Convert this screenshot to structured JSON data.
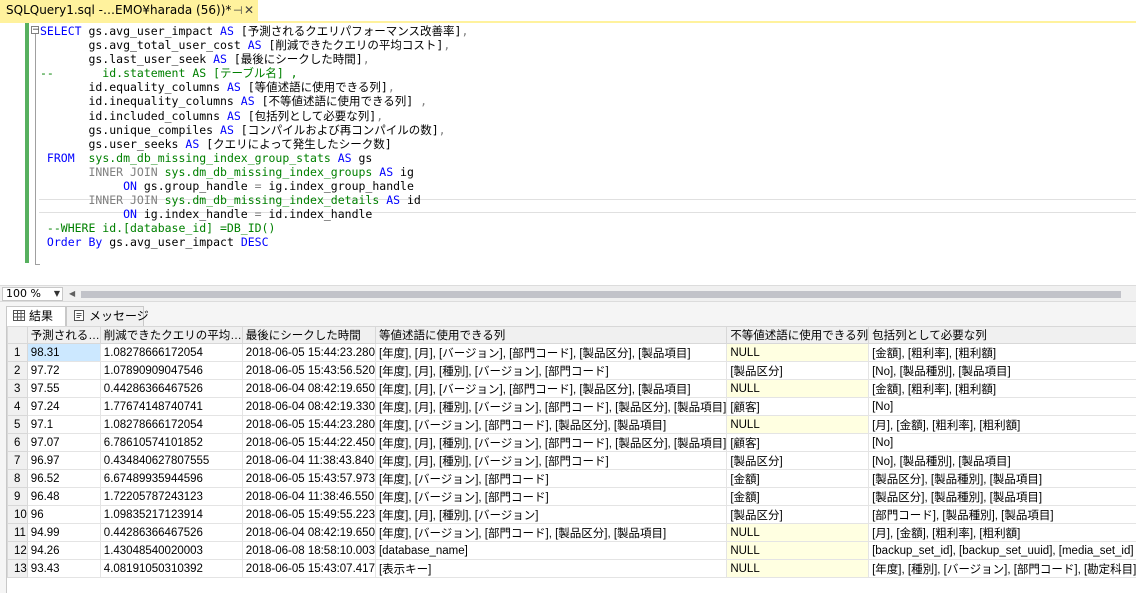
{
  "document_tab": {
    "title": "SQLQuery1.sql -…EMO¥harada (56))*",
    "pin_glyph": "⊣",
    "close_glyph": "✕"
  },
  "editor": {
    "lines": [
      [
        {
          "t": "SELECT ",
          "c": "kw"
        },
        {
          "t": "gs.avg_user_impact ",
          "c": ""
        },
        {
          "t": "AS ",
          "c": "kw"
        },
        {
          "t": "[予測されるクエリパフォーマンス改善率]",
          "c": ""
        },
        {
          "t": ",",
          "c": "gr"
        }
      ],
      [
        {
          "t": "       gs.avg_total_user_cost ",
          "c": ""
        },
        {
          "t": "AS ",
          "c": "kw"
        },
        {
          "t": "[削減できたクエリの平均コスト]",
          "c": ""
        },
        {
          "t": ",",
          "c": "gr"
        }
      ],
      [
        {
          "t": "       gs.last_user_seek ",
          "c": ""
        },
        {
          "t": "AS ",
          "c": "kw"
        },
        {
          "t": "[最後にシークした時間]",
          "c": ""
        },
        {
          "t": ",",
          "c": "gr"
        }
      ],
      [
        {
          "t": "--       id.statement AS [テーブル名] ,",
          "c": "cm"
        }
      ],
      [
        {
          "t": "       id.equality_columns ",
          "c": ""
        },
        {
          "t": "AS ",
          "c": "kw"
        },
        {
          "t": "[等値述語に使用できる列]",
          "c": ""
        },
        {
          "t": ",",
          "c": "gr"
        }
      ],
      [
        {
          "t": "       id.inequality_columns ",
          "c": ""
        },
        {
          "t": "AS ",
          "c": "kw"
        },
        {
          "t": "[不等値述語に使用できる列] ",
          "c": ""
        },
        {
          "t": ",",
          "c": "gr"
        }
      ],
      [
        {
          "t": "       id.included_columns ",
          "c": ""
        },
        {
          "t": "AS ",
          "c": "kw"
        },
        {
          "t": "[包括列として必要な列]",
          "c": ""
        },
        {
          "t": ",",
          "c": "gr"
        }
      ],
      [
        {
          "t": "       gs.unique_compiles ",
          "c": ""
        },
        {
          "t": "AS ",
          "c": "kw"
        },
        {
          "t": "[コンパイルおよび再コンパイルの数]",
          "c": ""
        },
        {
          "t": ",",
          "c": "gr"
        }
      ],
      [
        {
          "t": "       gs.user_seeks ",
          "c": ""
        },
        {
          "t": "AS ",
          "c": "kw"
        },
        {
          "t": "[クエリによって発生したシーク数]",
          "c": ""
        }
      ],
      [
        {
          "t": " FROM  ",
          "c": "kw"
        },
        {
          "t": "sys.dm_db_missing_index_group_stats ",
          "c": "sv"
        },
        {
          "t": "AS ",
          "c": "kw"
        },
        {
          "t": "gs",
          "c": ""
        }
      ],
      [
        {
          "t": "       INNER JOIN ",
          "c": "gr"
        },
        {
          "t": "sys.dm_db_missing_index_groups ",
          "c": "sv"
        },
        {
          "t": "AS ",
          "c": "kw"
        },
        {
          "t": "ig",
          "c": ""
        }
      ],
      [
        {
          "t": "            ON ",
          "c": "kw"
        },
        {
          "t": "gs.group_handle ",
          "c": ""
        },
        {
          "t": "= ",
          "c": "gr"
        },
        {
          "t": "ig.index_group_handle",
          "c": ""
        }
      ],
      [
        {
          "t": "       INNER JOIN ",
          "c": "gr"
        },
        {
          "t": "sys.dm_db_missing_index_details ",
          "c": "sv"
        },
        {
          "t": "AS ",
          "c": "kw"
        },
        {
          "t": "id",
          "c": ""
        }
      ],
      [
        {
          "t": "            ON ",
          "c": "kw"
        },
        {
          "t": "ig.index_handle ",
          "c": ""
        },
        {
          "t": "= ",
          "c": "gr"
        },
        {
          "t": "id.index_handle",
          "c": ""
        }
      ],
      [
        {
          "t": " --WHERE id.[database_id] =DB_ID()",
          "c": "cm"
        }
      ],
      [
        {
          "t": " Order By ",
          "c": "kw"
        },
        {
          "t": "gs.avg_user_impact ",
          "c": ""
        },
        {
          "t": "DESC",
          "c": "kw"
        }
      ]
    ]
  },
  "zoom": {
    "value": "100 %",
    "arrow": "▼"
  },
  "results_tabs": {
    "results": "結果",
    "messages": "メッセージ"
  },
  "grid": {
    "columns": [
      "予測される…",
      "削減できたクエリの平均…",
      "最後にシークした時間",
      "等値述語に使用できる列",
      "不等値述語に使用できる列",
      "包括列として必要な列"
    ],
    "rows": [
      [
        "1",
        "98.31",
        "1.08278666172054",
        "2018-06-05  15:44:23.280",
        "[年度], [月], [バージョン], [部門コード], [製品区分], [製品項目]",
        "NULL",
        "[金額], [粗利率], [粗利額]"
      ],
      [
        "2",
        "97.72",
        "1.07890909047546",
        "2018-06-05  15:43:56.520",
        "[年度], [月], [種別], [バージョン], [部門コード]",
        "[製品区分]",
        "[No], [製品種別], [製品項目]"
      ],
      [
        "3",
        "97.55",
        "0.44286366467526",
        "2018-06-04  08:42:19.650",
        "[年度], [月], [バージョン], [部門コード], [製品区分], [製品項目]",
        "NULL",
        "[金額], [粗利率], [粗利額]"
      ],
      [
        "4",
        "97.24",
        "1.77674148740741",
        "2018-06-04  08:42:19.330",
        "[年度], [月], [種別], [バージョン], [部門コード], [製品区分], [製品項目]",
        "[顧客]",
        "[No]"
      ],
      [
        "5",
        "97.1",
        "1.08278666172054",
        "2018-06-05  15:44:23.280",
        "[年度], [バージョン], [部門コード], [製品区分], [製品項目]",
        "NULL",
        "[月], [金額], [粗利率], [粗利額]"
      ],
      [
        "6",
        "97.07",
        "6.78610574101852",
        "2018-06-05  15:44:22.450",
        "[年度], [月], [種別], [バージョン], [部門コード], [製品区分], [製品項目]",
        "[顧客]",
        "[No]"
      ],
      [
        "7",
        "96.97",
        "0.434840627807555",
        "2018-06-04  11:38:43.840",
        "[年度], [月], [種別], [バージョン], [部門コード]",
        "[製品区分]",
        "[No], [製品種別], [製品項目]"
      ],
      [
        "8",
        "96.52",
        "6.67489935944596",
        "2018-06-05  15:43:57.973",
        "[年度], [バージョン], [部門コード]",
        "[金額]",
        "[製品区分], [製品種別], [製品項目]"
      ],
      [
        "9",
        "96.48",
        "1.72205787243123",
        "2018-06-04  11:38:46.550",
        "[年度], [バージョン], [部門コード]",
        "[金額]",
        "[製品区分], [製品種別], [製品項目]"
      ],
      [
        "10",
        "96",
        "1.09835217123914",
        "2018-06-05  15:49:55.223",
        "[年度], [月], [種別], [バージョン]",
        "[製品区分]",
        "[部門コード], [製品種別], [製品項目]"
      ],
      [
        "11",
        "94.99",
        "0.44286366467526",
        "2018-06-04  08:42:19.650",
        "[年度], [バージョン], [部門コード], [製品区分], [製品項目]",
        "NULL",
        "[月], [金額], [粗利率], [粗利額]"
      ],
      [
        "12",
        "94.26",
        "1.43048540020003",
        "2018-06-08  18:58:10.003",
        "[database_name]",
        "NULL",
        "[backup_set_id], [backup_set_uuid], [media_set_id]"
      ],
      [
        "13",
        "93.43",
        "4.08191050310392",
        "2018-06-05  15:43:07.417",
        "[表示キー]",
        "NULL",
        "[年度], [種別], [バージョン], [部門コード], [勘定科目]"
      ]
    ]
  },
  "colors": {
    "tab_active": "#fff29d",
    "keyword": "#0000ff",
    "system_view": "#008000",
    "comment": "#008000",
    "operator": "#808080",
    "null_cell": "#ffffe1",
    "selected_cell": "#cce8ff"
  }
}
